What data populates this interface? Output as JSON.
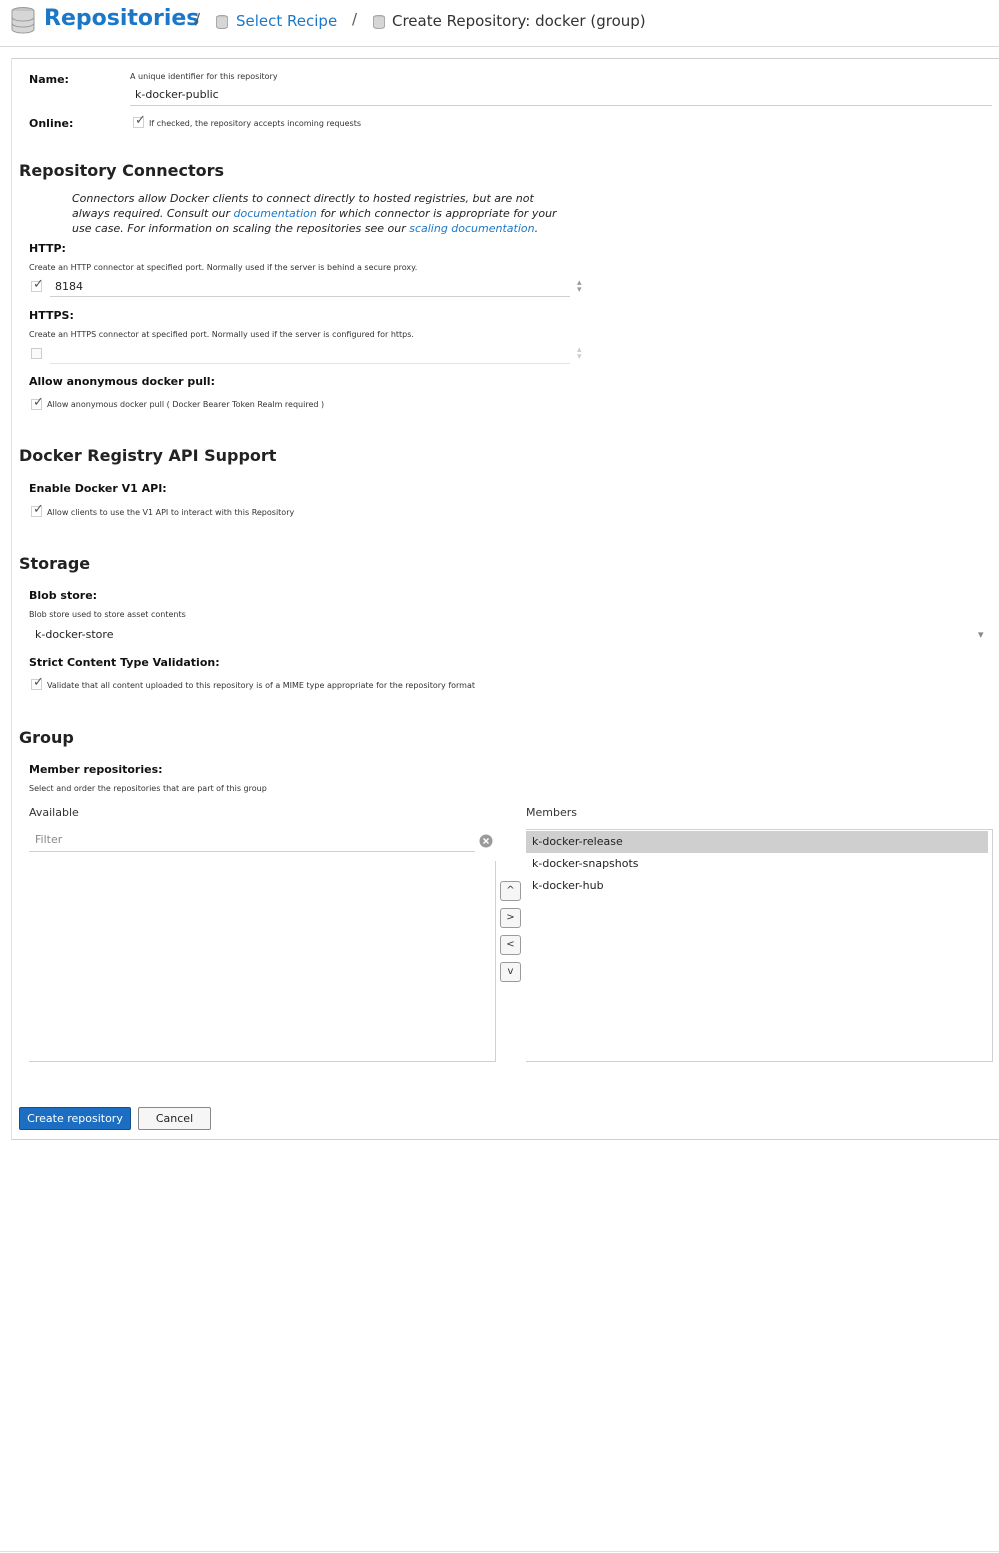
{
  "breadcrumb": {
    "title": "Repositories",
    "separator": "/",
    "link": "Select Recipe",
    "current": "Create Repository: docker (group)"
  },
  "name": {
    "label": "Name:",
    "help": "A unique identifier for this repository",
    "value": "k-docker-public"
  },
  "online": {
    "label": "Online:",
    "help": "If checked, the repository accepts incoming requests",
    "checked": true
  },
  "connectors": {
    "heading": "Repository Connectors",
    "note_1": "Connectors allow Docker clients to connect directly to hosted registries, but are not always required. Consult our ",
    "note_link_1": "documentation",
    "note_2": " for which connector is appropriate for your use case. For information on scaling the repositories see our ",
    "note_link_2": "scaling documentation",
    "note_3": ".",
    "http": {
      "label": "HTTP:",
      "help": "Create an HTTP connector at specified port. Normally used if the server is behind a secure proxy.",
      "checked": true,
      "value": "8184"
    },
    "https": {
      "label": "HTTPS:",
      "help": "Create an HTTPS connector at specified port. Normally used if the server is configured for https.",
      "checked": false,
      "value": ""
    },
    "anonymous": {
      "label": "Allow anonymous docker pull:",
      "help": "Allow anonymous docker pull ( Docker Bearer Token Realm required )",
      "checked": true
    }
  },
  "api": {
    "heading": "Docker Registry API Support",
    "v1_label": "Enable Docker V1 API:",
    "v1_help": "Allow clients to use the V1 API to interact with this Repository",
    "checked": true
  },
  "storage": {
    "heading": "Storage",
    "blob_label": "Blob store:",
    "blob_help": "Blob store used to store asset contents",
    "blob_value": "k-docker-store",
    "strict_label": "Strict Content Type Validation:",
    "strict_help": "Validate that all content uploaded to this repository is of a MIME type appropriate for the repository format",
    "strict_checked": true
  },
  "group": {
    "heading": "Group",
    "members_label": "Member repositories:",
    "members_help": "Select and order the repositories that are part of this group",
    "available_title": "Available",
    "filter_placeholder": "Filter",
    "members_title": "Members",
    "members": [
      "k-docker-release",
      "k-docker-snapshots",
      "k-docker-hub"
    ],
    "selected_member": "k-docker-release"
  },
  "buttons": {
    "create": "Create repository",
    "cancel": "Cancel"
  },
  "icons": {
    "arrow_up": "^",
    "arrow_right": ">",
    "arrow_left": "<",
    "arrow_down": "v",
    "check": "✓",
    "clear": "✕",
    "dropdown": "▾",
    "spinner_up": "▴",
    "spinner_down": "▾"
  },
  "colors": {
    "accent": "#1b78c8",
    "primary_button": "#1b6ec2",
    "selected_row": "#cfcfcf"
  }
}
